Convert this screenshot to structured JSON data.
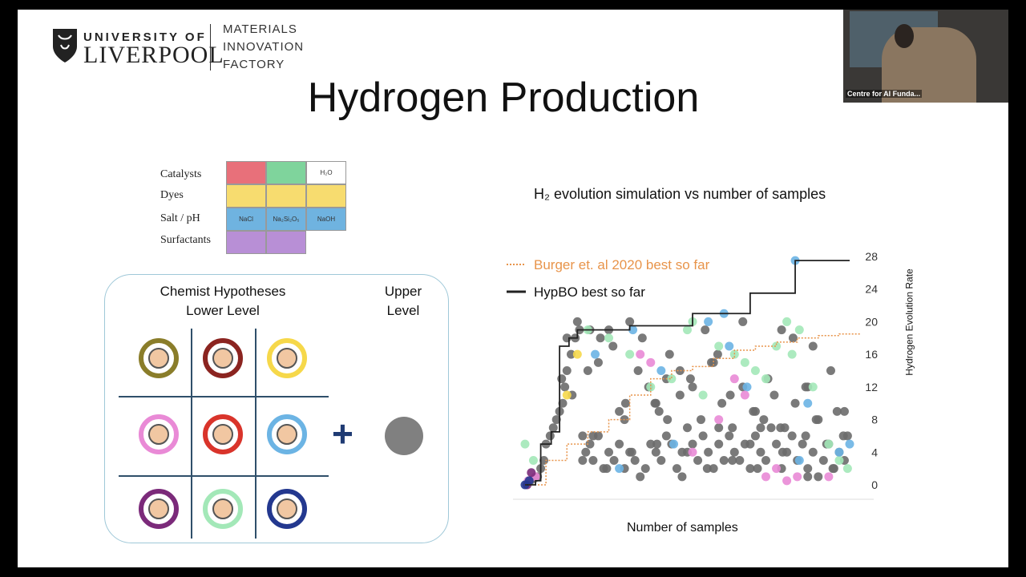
{
  "slide": {
    "logo": {
      "university_line1": "UNIVERSITY OF",
      "university_line2": "LIVERPOOL",
      "mif_line1": "MATERIALS",
      "mif_line2": "INNOVATION",
      "mif_line3": "FACTORY"
    },
    "title": "Hydrogen Production",
    "materials_table": {
      "rows": [
        {
          "label": "Catalysts",
          "cells": [
            "",
            "",
            "H₂O"
          ],
          "colors": [
            "#e8707a",
            "#7fd49c",
            "#ffffff"
          ]
        },
        {
          "label": "Dyes",
          "cells": [
            "",
            "",
            ""
          ],
          "colors": [
            "#f7dc6f",
            "#f7dc6f",
            "#f7dc6f"
          ]
        },
        {
          "label": "Salt / pH",
          "cells": [
            "NaCl",
            "Na₂Si₂O₅",
            "NaOH"
          ],
          "colors": [
            "#6fb3e0",
            "#6fb3e0",
            "#6fb3e0"
          ]
        },
        {
          "label": "Surfactants",
          "cells": [
            "",
            ""
          ],
          "colors": [
            "#b88fd6",
            "#b88fd6"
          ]
        }
      ]
    },
    "hypotheses": {
      "lower_heading_line1": "Chemist Hypotheses",
      "lower_heading_line2": "Lower Level",
      "upper_heading_line1": "Upper",
      "upper_heading_line2": "Level",
      "plus_symbol": "+",
      "avatar_colors": [
        "#8a7d2a",
        "#8b2420",
        "#f6d84a",
        "#e98ad6",
        "#d9342b",
        "#6cb4e4",
        "#7b2a7a",
        "#a3e8b8",
        "#23388f"
      ],
      "upper_level_color": "#808080"
    }
  },
  "webcam": {
    "label": "Centre for AI Funda..."
  },
  "chart_data": {
    "type": "scatter",
    "title": "H₂ evolution simulation vs number of samples",
    "xlabel": "Number of samples",
    "ylabel": "Hydrogen Evolution Rate",
    "xlim": [
      0,
      310
    ],
    "ylim": [
      0,
      28
    ],
    "x_ticks": [
      0,
      100,
      200,
      300
    ],
    "y_ticks": [
      0,
      4,
      8,
      12,
      16,
      20,
      24,
      28
    ],
    "legend_position": "top-left",
    "series": [
      {
        "name": "Burger et. al 2020 best so far",
        "kind": "step-line",
        "color": "#e8944a",
        "style": "dotted",
        "x": [
          0,
          20,
          40,
          60,
          80,
          100,
          120,
          140,
          160,
          180,
          200,
          220,
          240,
          260,
          280,
          300,
          320
        ],
        "y": [
          0,
          3,
          5,
          6.5,
          8,
          11,
          13,
          14,
          14.5,
          15.5,
          16.5,
          17,
          17.5,
          18,
          18.3,
          18.5,
          18.5
        ]
      },
      {
        "name": "HypBO best so far",
        "kind": "step-line",
        "color": "#222222",
        "style": "solid",
        "x": [
          0,
          10,
          15,
          25,
          33,
          42,
          50,
          100,
          160,
          215,
          258,
          310
        ],
        "y": [
          0,
          0.5,
          5,
          6.5,
          17,
          18,
          19,
          19.5,
          21,
          23.5,
          27.5,
          27.5
        ]
      },
      {
        "name": "",
        "kind": "points",
        "color": "#6b6b6b",
        "x": [
          5,
          9,
          12,
          15,
          18,
          20,
          24,
          27,
          30,
          33,
          36,
          38,
          40,
          44,
          48,
          52,
          55,
          58,
          62,
          65,
          70,
          75,
          80,
          85,
          90,
          95,
          100,
          105,
          110,
          115,
          120,
          125,
          130,
          135,
          140,
          145,
          150,
          155,
          160,
          165,
          170,
          175,
          180,
          185,
          190,
          195,
          200,
          205,
          210,
          215,
          220,
          225,
          230,
          235,
          240,
          245,
          250,
          255,
          260,
          265,
          270,
          275,
          280,
          285,
          290,
          295,
          300,
          305,
          308,
          62,
          72,
          84,
          96,
          108,
          118,
          128,
          138,
          148,
          158,
          168,
          178,
          188,
          198,
          208,
          218,
          228,
          238,
          248,
          258,
          268,
          278,
          288,
          298,
          55,
          78,
          102,
          126,
          150,
          174,
          198,
          222,
          246,
          270,
          294,
          45,
          90,
          135,
          180,
          225,
          270,
          35,
          65,
          95,
          125,
          155,
          185,
          215,
          245,
          275,
          305,
          40,
          50,
          60,
          70,
          80,
          100,
          112,
          124,
          136,
          148,
          160,
          172,
          184,
          196,
          208,
          220,
          232,
          244,
          256,
          268,
          280,
          292,
          304
        ],
        "y": [
          0.5,
          0.8,
          1,
          2,
          3,
          5,
          6,
          7,
          8,
          9,
          10,
          12,
          14,
          16,
          18,
          19,
          6,
          4,
          5,
          3,
          6,
          2,
          4,
          3,
          5,
          2,
          4,
          3,
          1,
          2,
          5,
          4,
          3,
          6,
          5,
          2,
          4,
          7,
          5,
          3,
          6,
          4,
          2,
          5,
          3,
          6,
          4,
          3,
          5,
          2,
          6,
          4,
          3,
          7,
          5,
          2,
          4,
          6,
          3,
          5,
          2,
          4,
          1,
          3,
          5,
          2,
          4,
          3,
          6,
          19,
          18,
          17,
          10,
          14,
          12,
          9,
          16,
          11,
          13,
          8,
          15,
          10,
          7,
          12,
          9,
          8,
          11,
          7,
          10,
          6,
          8,
          5,
          9,
          3,
          2,
          4,
          5,
          1,
          2,
          3,
          2,
          4,
          1,
          2,
          11,
          9,
          13,
          15,
          7,
          12,
          13,
          6,
          8,
          10,
          4,
          7,
          5,
          19,
          17,
          9,
          18,
          20,
          14,
          15,
          19,
          20,
          18,
          10,
          8,
          14,
          12,
          19,
          16,
          11,
          20,
          9,
          13,
          7,
          18,
          12,
          8,
          14,
          6
        ]
      },
      {
        "name": "",
        "kind": "points",
        "color": "#a3e8b8",
        "x": [
          0,
          8,
          60,
          80,
          100,
          120,
          140,
          155,
          160,
          170,
          185,
          200,
          210,
          220,
          230,
          240,
          250,
          255,
          262,
          275,
          290,
          300,
          308
        ],
        "y": [
          5,
          3,
          19,
          18,
          16,
          12,
          13,
          19,
          20,
          11,
          17,
          16,
          15,
          14,
          13,
          17,
          20,
          16,
          19,
          12,
          5,
          3,
          2
        ]
      },
      {
        "name": "",
        "kind": "points",
        "color": "#6cb4e4",
        "x": [
          67,
          90,
          103,
          130,
          142,
          175,
          190,
          195,
          212,
          258,
          262,
          270,
          300,
          310
        ],
        "y": [
          16,
          2,
          19,
          14,
          5,
          20,
          21,
          17,
          12,
          27.5,
          3,
          10,
          4,
          5
        ]
      },
      {
        "name": "",
        "kind": "points",
        "color": "#e98ad6",
        "x": [
          3,
          10,
          120,
          110,
          160,
          185,
          200,
          210,
          230,
          240,
          250,
          260,
          290
        ],
        "y": [
          0.5,
          1,
          15,
          16,
          4,
          8,
          13,
          11,
          1,
          2,
          0.5,
          1,
          1
        ]
      },
      {
        "name": "",
        "kind": "points",
        "color": "#f6d84a",
        "x": [
          40,
          50
        ],
        "y": [
          11,
          16
        ]
      },
      {
        "name": "",
        "kind": "points",
        "color": "#7b2a7a",
        "x": [
          2,
          6
        ],
        "y": [
          0,
          1.5
        ]
      },
      {
        "name": "",
        "kind": "points",
        "color": "#23388f",
        "x": [
          0,
          4
        ],
        "y": [
          0,
          0.5
        ]
      }
    ]
  }
}
